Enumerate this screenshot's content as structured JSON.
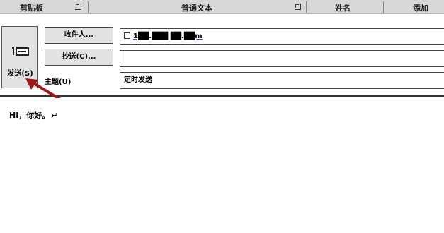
{
  "ribbon": {
    "groups": [
      "剪贴板",
      "普通文本",
      "姓名",
      "添加"
    ]
  },
  "send_button": {
    "label": "发送(S)"
  },
  "fields": {
    "to_button": "收件人...",
    "cc_button": "抄送(C)...",
    "subject_label": "主题(U)",
    "to_value": "1██.███ ██.██m",
    "cc_value": "",
    "subject_value": "定时发送"
  },
  "message": {
    "body_text": "HI，你好。",
    "return_mark": "↵"
  },
  "colors": {
    "annotation_arrow": "#9b1b1b",
    "ribbon_bg": "#d8d8d8",
    "button_bg": "#e2e2e2"
  }
}
